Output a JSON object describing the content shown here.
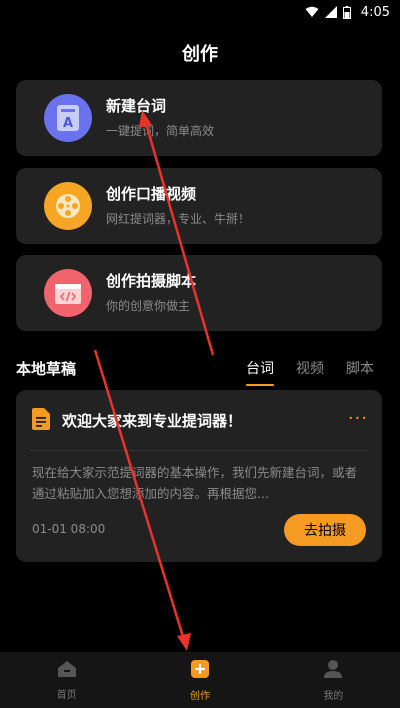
{
  "status_bar": {
    "time": "4:05"
  },
  "page": {
    "title": "创作"
  },
  "cards": [
    {
      "title": "新建台词",
      "subtitle": "一键提词，简单高效",
      "icon": "doc-a-icon",
      "color": "#6a72f0"
    },
    {
      "title": "创作口播视频",
      "subtitle": "网红提词器，专业、牛掰！",
      "icon": "film-reel-icon",
      "color": "#f5a623"
    },
    {
      "title": "创作拍摄脚本",
      "subtitle": "你的创意你做主",
      "icon": "code-clapper-icon",
      "color": "#f0646e"
    }
  ],
  "drafts": {
    "title": "本地草稿",
    "tabs": [
      {
        "label": "台词",
        "active": true
      },
      {
        "label": "视频",
        "active": false
      },
      {
        "label": "脚本",
        "active": false
      }
    ],
    "item": {
      "title": "欢迎大家来到专业提词器！",
      "more": "···",
      "body": "现在给大家示范提词器的基本操作，我们先新建台词，或者通过粘贴加入您想添加的内容。再根据您...",
      "date": "01-01 08:00",
      "action": "去拍摄"
    }
  },
  "bottom_nav": [
    {
      "label": "首页",
      "icon": "home-icon",
      "active": false
    },
    {
      "label": "创作",
      "icon": "plus-square-icon",
      "active": true
    },
    {
      "label": "我的",
      "icon": "person-icon",
      "active": false
    }
  ],
  "colors": {
    "accent": "#f59a23",
    "card_bg": "#222222",
    "annotation": "#e8332a"
  }
}
